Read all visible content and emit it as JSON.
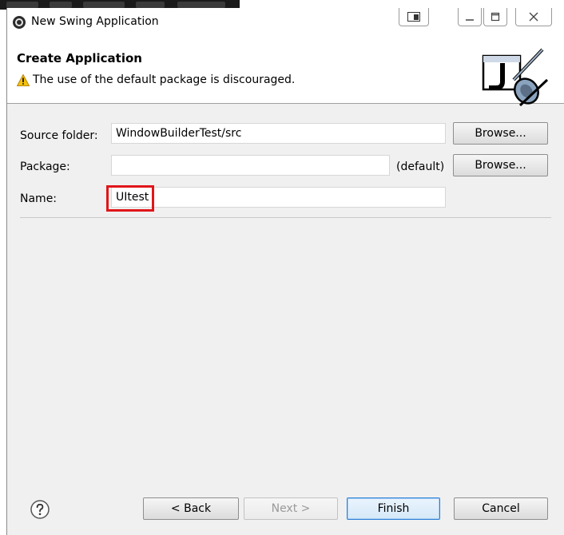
{
  "window": {
    "title": "New Swing Application"
  },
  "header": {
    "heading": "Create Application",
    "warning": "The use of the default package is discouraged."
  },
  "form": {
    "source_folder_label": "Source folder:",
    "source_folder_value": "WindowBuilderTest/src",
    "package_label": "Package:",
    "package_value": "",
    "package_hint": "(default)",
    "name_label": "Name:",
    "name_value": "UItest",
    "browse_label": "Browse..."
  },
  "footer": {
    "back_label": "< Back",
    "next_label": "Next >",
    "finish_label": "Finish",
    "cancel_label": "Cancel"
  },
  "colors": {
    "highlight": "#e0161b",
    "primary_border": "#2b7fd6",
    "dialog_bg": "#f0f0f0"
  },
  "icons": [
    "app-icon",
    "restore-icon",
    "minimize-icon",
    "maximize-icon",
    "close-icon",
    "warning-icon",
    "java-banner-icon",
    "help-icon"
  ]
}
